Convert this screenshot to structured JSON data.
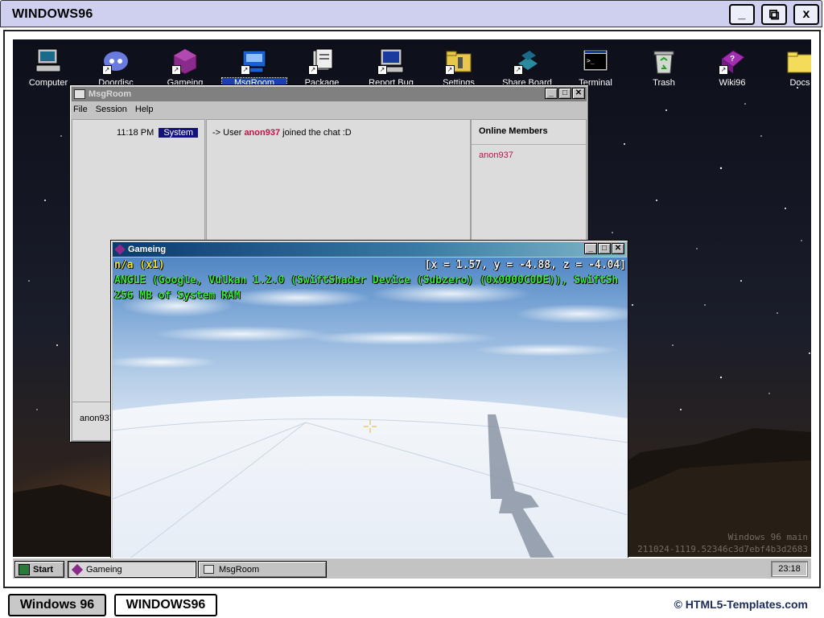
{
  "frame": {
    "title": "WINDOWS96",
    "buttons": {
      "minimize": "_",
      "restore": "⧉",
      "close": "x"
    }
  },
  "desktop": {
    "icons": [
      {
        "id": "computer",
        "label": "Computer"
      },
      {
        "id": "doordisc",
        "label": "Doordisc"
      },
      {
        "id": "gameing",
        "label": "Gameing"
      },
      {
        "id": "msgroom",
        "label": "MsgRoom",
        "selected": true
      },
      {
        "id": "package",
        "label": "Package"
      },
      {
        "id": "report-bug",
        "label": "Report Bug"
      },
      {
        "id": "settings",
        "label": "Settings"
      },
      {
        "id": "share-board",
        "label": "Share Board"
      },
      {
        "id": "terminal",
        "label": "Terminal"
      },
      {
        "id": "trash",
        "label": "Trash"
      },
      {
        "id": "wiki96",
        "label": "Wiki96"
      },
      {
        "id": "docs",
        "label": "Docs"
      }
    ],
    "watermark": {
      "line1": "Windows 96 main",
      "line2": "211024-1119.52346c3d7ebf4b3d2683"
    }
  },
  "msgroom": {
    "title": "MsgRoom",
    "menu": [
      "File",
      "Session",
      "Help"
    ],
    "timestamp": "11:18 PM",
    "tag": "System",
    "message": {
      "prefix": "-> User",
      "user": "anon937",
      "suffix": "joined the chat :D"
    },
    "members_header": "Online Members",
    "members": [
      "anon937"
    ],
    "input_user": "anon937"
  },
  "gameing": {
    "title": "Gameing",
    "debug": {
      "fps": "n/a (x1)",
      "coords": "[x = 1.57, y = -4.88, z = -4.04]",
      "renderer": "ANGLE (Google, Vulkan 1.2.0 (SwiftShader Device (Subzero) (0x0000C0DE)), SwiftSh",
      "ram": "256 MB of System RAM"
    }
  },
  "taskbar": {
    "start_label": "Start",
    "tasks": [
      {
        "label": "Gameing",
        "active": true
      },
      {
        "label": "MsgRoom",
        "active": false
      }
    ],
    "clock": "23:18"
  },
  "footer": {
    "tab1": "Windows 96",
    "tab2": "WINDOWS96",
    "credit": "© HTML5-Templates.com"
  },
  "colors": {
    "frame_titlebar": "#cfcfef",
    "msg_username": "#c0134a",
    "system_tag": "#13137a",
    "debug_yellow": "#f2e23a",
    "debug_green": "#39e83a"
  }
}
